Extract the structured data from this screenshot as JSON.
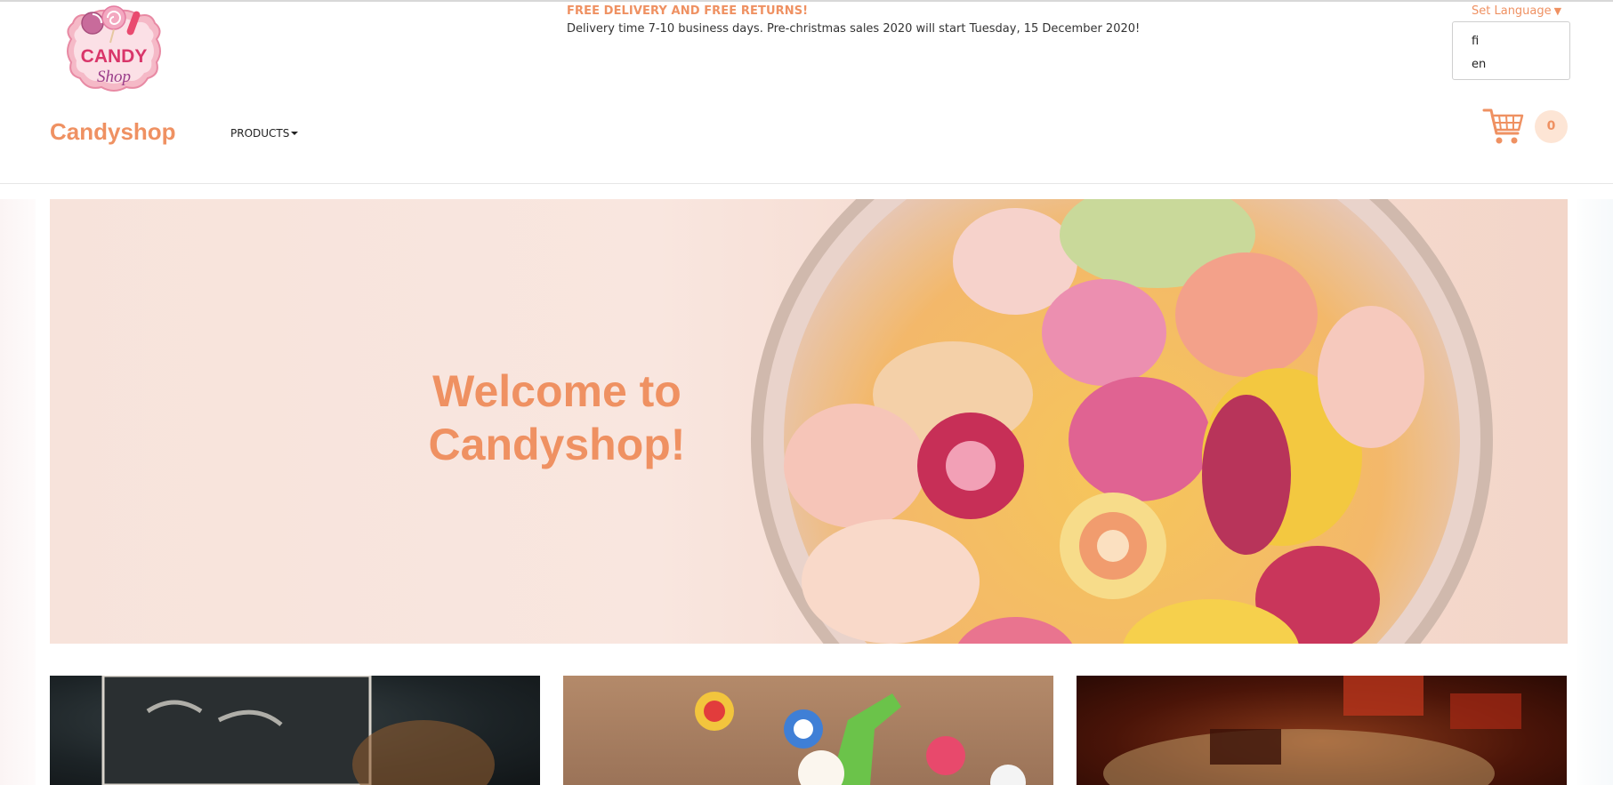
{
  "logo": {
    "line1": "CANDY",
    "line2": "Shop"
  },
  "promo": {
    "title": "FREE DELIVERY AND FREE RETURNS!",
    "text": "Delivery time 7-10 business days. Pre-christmas sales 2020 will start Tuesday, 15 December 2020!"
  },
  "language": {
    "toggle_label": "Set Language",
    "options": [
      "fi",
      "en"
    ]
  },
  "nav": {
    "brand": "Candyshop",
    "products_label": "PRODUCTS"
  },
  "cart": {
    "count": "0",
    "icon": "cart-icon"
  },
  "hero": {
    "line1": "Welcome to",
    "line2": "Candyshop!"
  },
  "colors": {
    "accent": "#ef9162",
    "badge_bg": "#fde5d5",
    "hero_bg": "#f7e3db"
  }
}
